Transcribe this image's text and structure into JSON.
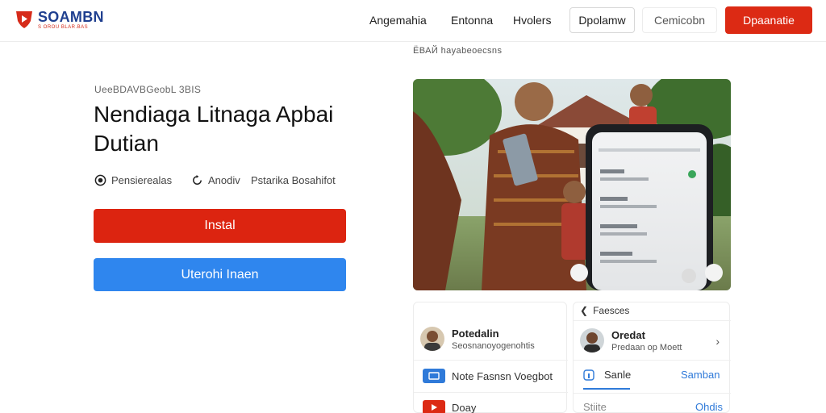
{
  "header": {
    "logo_name": "SOAMBN",
    "logo_tagline": "S OROU BLAR.BAS",
    "nav": [
      "Angemahia",
      "Entonna",
      "Hvolers"
    ],
    "btn_outline_1": "Dpolamw",
    "btn_outline_2": "Cemicobn",
    "btn_primary": "Dpaanatie"
  },
  "hero": {
    "small_caption": "ЁВАЙ  hayabeoecsns",
    "eyebrow": "UeeBDAVBGeobL 3BIS",
    "title": "Nendiaga Litnaga Apbai Dutian",
    "meta": [
      "Pensierealas",
      "Anodiv",
      "Pstarika Bosahifot"
    ],
    "install_label": "Instal",
    "secondary_label": "Uterohi Inaen"
  },
  "cards": {
    "left": {
      "profile_name": "Potedalin",
      "profile_sub": "Seosnanoyogenohtis",
      "item_1": "Note Fasnsn Voegbot",
      "item_2": "Doay"
    },
    "right": {
      "header": "Faesces",
      "profile_name": "Oredat",
      "profile_sub": "Predaan op Moett",
      "tab_1": "Sanle",
      "tab_2": "Samban",
      "footer_1": "Stiite",
      "footer_2": "Ohdis"
    }
  },
  "colors": {
    "accent_red": "#dc2a14",
    "accent_blue": "#2f86ee",
    "brand_navy": "#1f3f8f"
  }
}
